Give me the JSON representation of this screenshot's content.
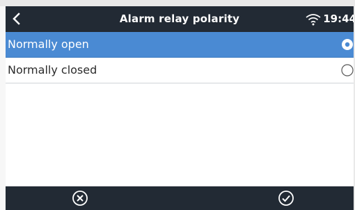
{
  "header": {
    "back_icon": "chevron-left-icon",
    "title": "Alarm relay polarity",
    "wifi_icon": "wifi-icon",
    "time": "19:44"
  },
  "options": [
    {
      "label": "Normally open",
      "selected": true
    },
    {
      "label": "Normally closed",
      "selected": false
    }
  ],
  "footer": {
    "cancel_icon": "cancel-circle-icon",
    "confirm_icon": "check-circle-icon"
  },
  "colors": {
    "header_bg": "#222a34",
    "selected_bg": "#4a8ad3",
    "text": "#2b2b2b"
  }
}
